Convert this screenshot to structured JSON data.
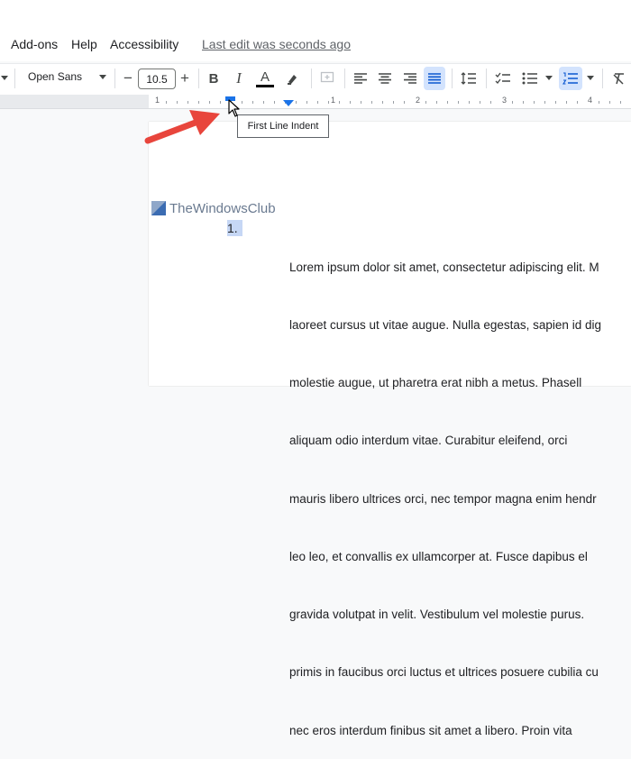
{
  "menu": {
    "items": [
      "Add-ons",
      "Help",
      "Accessibility"
    ],
    "last_edit": "Last edit was seconds ago"
  },
  "toolbar": {
    "font_name": "Open Sans",
    "font_size": "10.5",
    "minus": "−",
    "plus": "+",
    "bold": "B",
    "italic": "I",
    "text_color": "A"
  },
  "ruler": {
    "numbers": [
      "1",
      "1",
      "2",
      "3",
      "4"
    ]
  },
  "tooltip": "First Line Indent",
  "watermark": "TheWindowsClub",
  "document": {
    "list_number": "1.",
    "lines": [
      "Lorem ipsum dolor sit amet, consectetur adipiscing elit. M",
      "laoreet cursus ut vitae augue. Nulla egestas, sapien id dig",
      "molestie augue, ut pharetra erat nibh a metus. Phasell",
      "aliquam odio interdum vitae. Curabitur eleifend, orci",
      "mauris libero ultrices orci, nec tempor magna enim hendr",
      "leo leo, et convallis ex ullamcorper at. Fusce dapibus el",
      "gravida volutpat in velit. Vestibulum vel molestie purus.",
      "primis in faucibus orci luctus et ultrices posuere cubilia cu",
      "nec eros interdum finibus sit amet a libero. Proin vita"
    ]
  },
  "colors": {
    "accent": "#1a73e8",
    "arrow": "#e8453c",
    "selection": "#c6d7f5"
  }
}
